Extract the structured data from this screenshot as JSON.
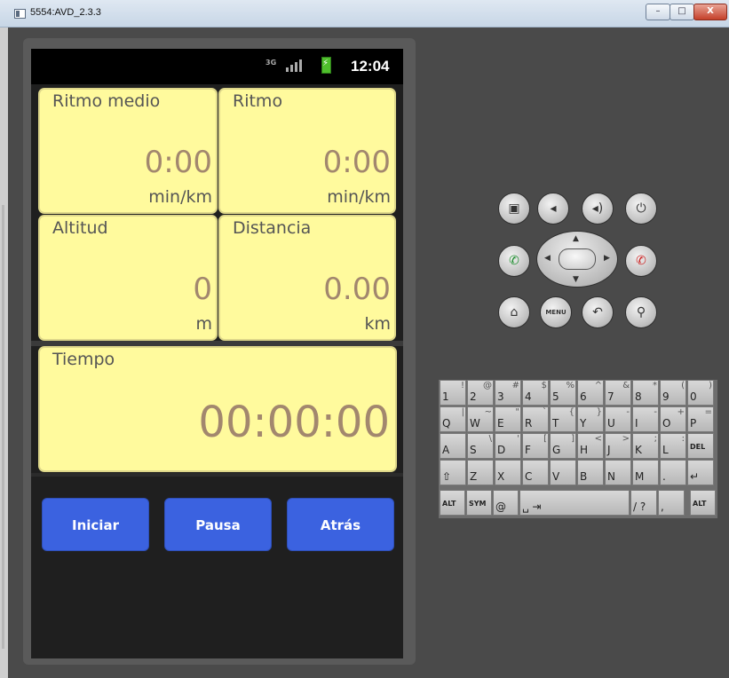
{
  "window": {
    "title": "5554:AVD_2.3.3",
    "min_symbol": "–",
    "max_symbol": "□",
    "close_symbol": "X"
  },
  "statusbar": {
    "network": "3G",
    "time": "12:04"
  },
  "metrics": {
    "ritmo_medio": {
      "label": "Ritmo medio",
      "value": "0:00",
      "unit": "min/km"
    },
    "ritmo": {
      "label": "Ritmo",
      "value": "0:00",
      "unit": "min/km"
    },
    "altitud": {
      "label": "Altitud",
      "value": "0",
      "unit": "m"
    },
    "distancia": {
      "label": "Distancia",
      "value": "0.00",
      "unit": "km"
    },
    "tiempo": {
      "label": "Tiempo",
      "value": "00:00:00"
    }
  },
  "actions": {
    "iniciar": "Iniciar",
    "pausa": "Pausa",
    "atras": "Atrás"
  },
  "hardware": {
    "menu_label": "MENU"
  },
  "keyboard": {
    "rows": [
      [
        [
          "1",
          "!"
        ],
        [
          "2",
          "@"
        ],
        [
          "3",
          "#"
        ],
        [
          "4",
          "$"
        ],
        [
          "5",
          "%"
        ],
        [
          "6",
          "^"
        ],
        [
          "7",
          "&"
        ],
        [
          "8",
          "*"
        ],
        [
          "9",
          "("
        ],
        [
          "0",
          ")"
        ]
      ],
      [
        [
          "Q",
          "|"
        ],
        [
          "W",
          "~"
        ],
        [
          "E",
          "\""
        ],
        [
          "R",
          "`"
        ],
        [
          "T",
          "{"
        ],
        [
          "Y",
          "}"
        ],
        [
          "U",
          "-"
        ],
        [
          "I",
          "-"
        ],
        [
          "O",
          "+"
        ],
        [
          "P",
          "="
        ]
      ],
      [
        [
          "A",
          ""
        ],
        [
          "S",
          "\\"
        ],
        [
          "D",
          "'"
        ],
        [
          "F",
          "["
        ],
        [
          "G",
          "]"
        ],
        [
          "H",
          "<"
        ],
        [
          "J",
          ">"
        ],
        [
          "K",
          ";"
        ],
        [
          "L",
          ":"
        ],
        [
          "DEL",
          ""
        ]
      ],
      [
        [
          "⇧",
          ""
        ],
        [
          "Z",
          ""
        ],
        [
          "X",
          ""
        ],
        [
          "C",
          ""
        ],
        [
          "V",
          ""
        ],
        [
          "B",
          ""
        ],
        [
          "N",
          ""
        ],
        [
          "M",
          ""
        ],
        [
          ".",
          ""
        ],
        [
          "↵",
          ""
        ]
      ]
    ],
    "bottom": {
      "alt": "ALT",
      "sym": "SYM",
      "at": "@",
      "space": "␣",
      "tab": "⇥",
      "slash": "/",
      "question": "?",
      "comma": ",",
      "alt2": "ALT"
    }
  },
  "colors": {
    "tile_bg": "#fffa9d",
    "value_color": "#a2876e",
    "button_blue": "#3b62e0"
  }
}
